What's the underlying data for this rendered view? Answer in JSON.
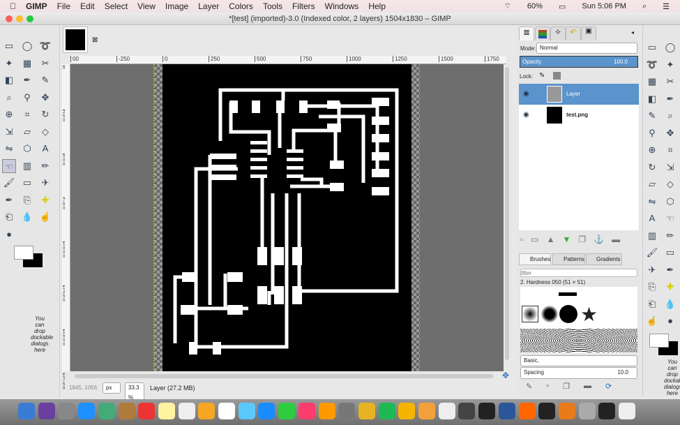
{
  "menubar": {
    "apple": "",
    "app": "GIMP",
    "items": [
      "File",
      "Edit",
      "Select",
      "View",
      "Image",
      "Layer",
      "Colors",
      "Tools",
      "Filters",
      "Windows",
      "Help"
    ],
    "battery": "60%",
    "clock": "Sun 5:06 PM"
  },
  "window": {
    "title": "*[test] (imported)-3.0 (Indexed color, 2 layers) 1504x1830 – GIMP"
  },
  "rulers": {
    "horizontal": [
      "00",
      "-250",
      "0",
      "250",
      "500",
      "750",
      "1000",
      "1250",
      "1500",
      "1750"
    ],
    "vertical": [
      "0",
      "250",
      "500",
      "750",
      "1000",
      "1250",
      "1500",
      "1750"
    ]
  },
  "layers_panel": {
    "mode_label": "Mode:",
    "mode_value": "Normal",
    "opacity_label": "Opacity",
    "opacity_value": "100.0",
    "lock_label": "Lock:",
    "layers": [
      {
        "name": "Layer",
        "selected": true,
        "visible": true
      },
      {
        "name": "test.png",
        "selected": false,
        "visible": true
      }
    ]
  },
  "brushes_panel": {
    "tabs": [
      "Brushes",
      "Patterns",
      "Gradients"
    ],
    "filter_placeholder": "filter",
    "brush_name": "2. Hardness 050 (51 × 51)",
    "preset": "Basic,",
    "spacing_label": "Spacing",
    "spacing_value": "10.0"
  },
  "toolbox": {
    "drop_hint": "You can drop dockable dialogs here"
  },
  "status": {
    "coords": "1845, 1056",
    "unit": "px",
    "zoom": "33.3 %",
    "layer_info": "Layer (27.2 MB)"
  },
  "colors": {
    "accent": "#5b93cc",
    "canvas_bg": "#6e6e6e",
    "image_bg": "#000000",
    "trace": "#ffffff"
  }
}
